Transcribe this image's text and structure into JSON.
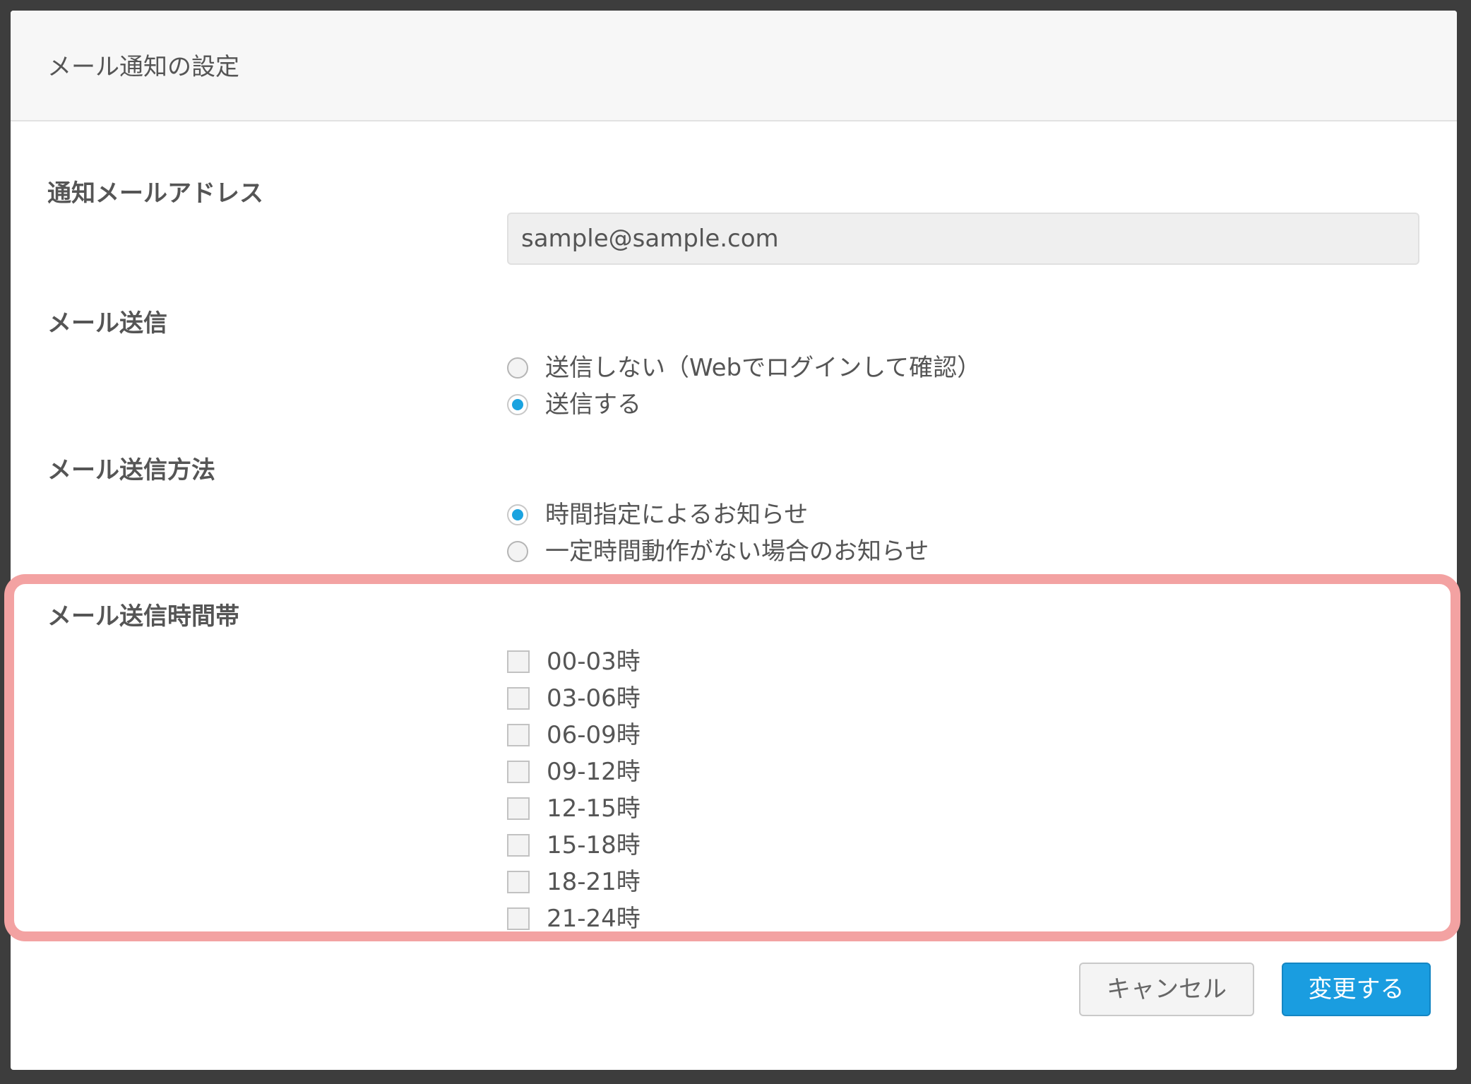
{
  "dialog": {
    "title": "メール通知の設定"
  },
  "email_section": {
    "label": "通知メールアドレス",
    "value": "sample@sample.com"
  },
  "send_section": {
    "label": "メール送信",
    "options": [
      {
        "label": "送信しない（Webでログインして確認）",
        "checked": false
      },
      {
        "label": "送信する",
        "checked": true
      }
    ]
  },
  "method_section": {
    "label": "メール送信方法",
    "options": [
      {
        "label": "時間指定によるお知らせ",
        "checked": true
      },
      {
        "label": "一定時間動作がない場合のお知らせ",
        "checked": false
      }
    ]
  },
  "time_section": {
    "label": "メール送信時間帯",
    "slots": [
      {
        "label": "00-03時",
        "checked": false
      },
      {
        "label": "03-06時",
        "checked": false
      },
      {
        "label": "06-09時",
        "checked": false
      },
      {
        "label": "09-12時",
        "checked": false
      },
      {
        "label": "12-15時",
        "checked": false
      },
      {
        "label": "15-18時",
        "checked": false
      },
      {
        "label": "18-21時",
        "checked": false
      },
      {
        "label": "21-24時",
        "checked": false
      }
    ]
  },
  "buttons": {
    "cancel_label": "キャンセル",
    "submit_label": "変更する"
  },
  "colors": {
    "accent": "#1a9de0",
    "highlight": "#f3a2a2"
  }
}
